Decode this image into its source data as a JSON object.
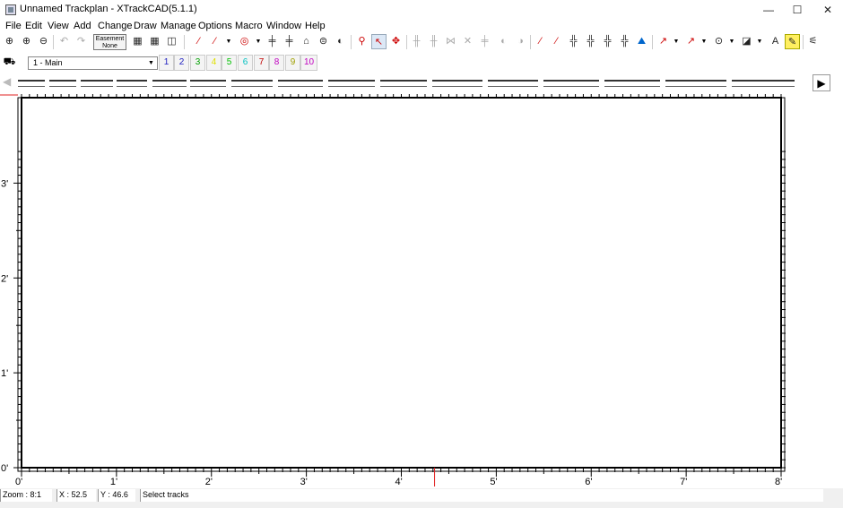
{
  "window": {
    "title": "Unnamed Trackplan - XTrackCAD(5.1.1)",
    "minimize": "—",
    "maximize": "☐",
    "close": "✕"
  },
  "menu": [
    "File",
    "Edit",
    "View",
    "Add",
    "Change",
    "Draw",
    "Manage",
    "Options",
    "Macro",
    "Window",
    "Help"
  ],
  "toolbar": {
    "easement_line1": "Easement",
    "easement_line2": "None"
  },
  "layers": {
    "current": "1 - Main",
    "buttons": [
      "1",
      "2",
      "3",
      "4",
      "5",
      "6",
      "7",
      "8",
      "9",
      "10"
    ],
    "colors": [
      "#2020c0",
      "#2020c0",
      "#00a000",
      "#e0e000",
      "#00c000",
      "#00c0c0",
      "#c00000",
      "#c000c0",
      "#a0a000",
      "#c000c0"
    ]
  },
  "ruler": {
    "x_labels": [
      "0'",
      "1'",
      "2'",
      "3'",
      "4'",
      "5'",
      "6'",
      "7'",
      "8'"
    ],
    "y_labels": [
      "3'",
      "2'",
      "1'",
      "0'"
    ]
  },
  "status": {
    "zoom": "Zoom : 8:1",
    "x": "X : 52.5",
    "y": "Y : 46.6",
    "message": "Select tracks"
  },
  "colors": {
    "ruler": "#000000",
    "cursor_marker": "#e02020",
    "canvas": "#ffffff"
  }
}
